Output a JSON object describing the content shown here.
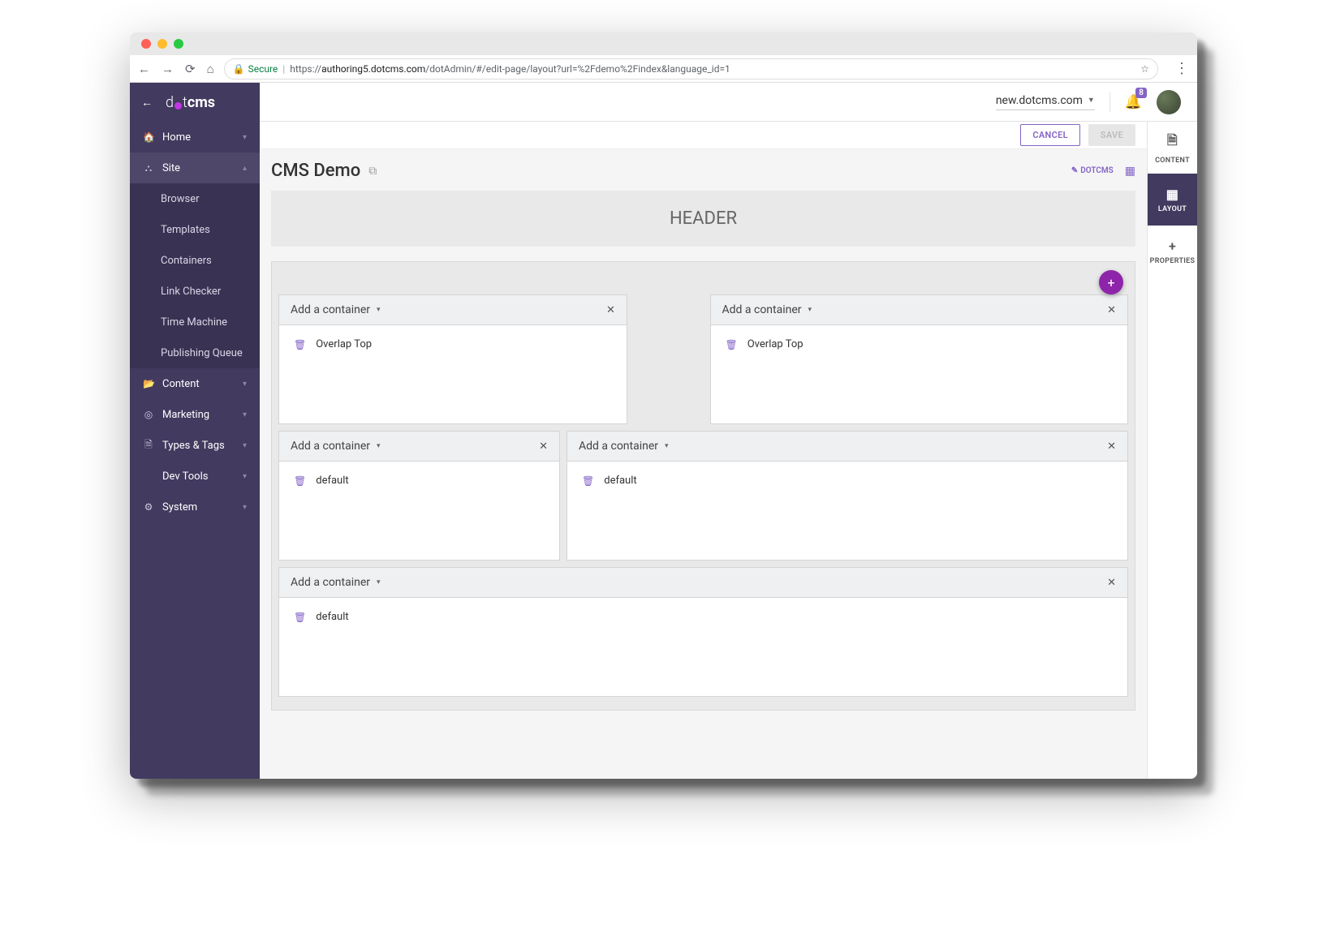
{
  "browser": {
    "secure_label": "Secure",
    "url_host": "authoring5.dotcms.com",
    "url_path": "/dotAdmin/#/edit-page/layout?url=%2Fdemo%2Findex&language_id=1",
    "url_prefix": "https://"
  },
  "logo": {
    "dot": "d",
    "ot": "t",
    "cms": "cms"
  },
  "sidebar": {
    "items": [
      {
        "label": "Home",
        "icon": "🏠",
        "expanded": false
      },
      {
        "label": "Site",
        "icon": "⛬",
        "expanded": true,
        "active": true,
        "children": [
          "Browser",
          "Templates",
          "Containers",
          "Link Checker",
          "Time Machine",
          "Publishing Queue"
        ]
      },
      {
        "label": "Content",
        "icon": "📂",
        "expanded": false
      },
      {
        "label": "Marketing",
        "icon": "◎",
        "expanded": false
      },
      {
        "label": "Types & Tags",
        "icon": "🗎",
        "expanded": false
      },
      {
        "label": "Dev Tools",
        "icon": "</>",
        "expanded": false
      },
      {
        "label": "System",
        "icon": "⚙",
        "expanded": false
      }
    ]
  },
  "header": {
    "site_selector": "new.dotcms.com",
    "notification_count": "8"
  },
  "actions": {
    "cancel": "CANCEL",
    "save": "SAVE"
  },
  "page": {
    "title": "CMS Demo",
    "edit_label": "DOTCMS",
    "header_block": "HEADER",
    "add_container_label": "Add a container",
    "rows": [
      {
        "cols": [
          {
            "width": 5,
            "items": [
              "Overlap Top"
            ]
          },
          {
            "width": 1,
            "gap": true
          },
          {
            "width": 6,
            "items": [
              "Overlap Top"
            ]
          }
        ]
      },
      {
        "cols": [
          {
            "width": 4,
            "items": [
              "default"
            ]
          },
          {
            "width": 8,
            "items": [
              "default"
            ]
          }
        ]
      },
      {
        "cols": [
          {
            "width": 12,
            "items": [
              "default"
            ]
          }
        ]
      }
    ]
  },
  "rail": {
    "items": [
      {
        "label": "CONTENT",
        "icon": "🗎"
      },
      {
        "label": "LAYOUT",
        "icon": "▦",
        "active": true
      },
      {
        "label": "PROPERTIES",
        "icon": "+"
      }
    ]
  }
}
